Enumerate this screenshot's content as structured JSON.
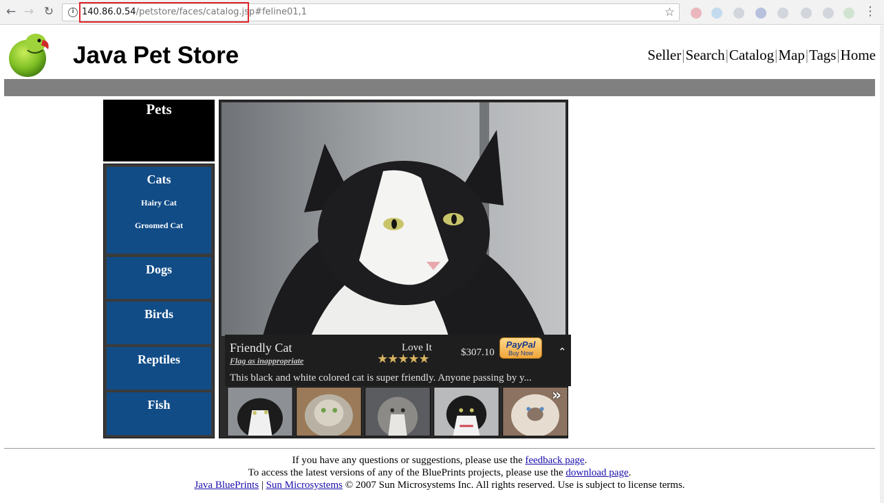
{
  "browser": {
    "url_host": "140.86.0.54",
    "url_path": "/petstore/faces/catalog.jsp",
    "url_hash": "#feline01,1"
  },
  "header": {
    "title": "Java Pet Store",
    "nav": [
      "Seller",
      "Search",
      "Catalog",
      "Map",
      "Tags",
      "Home"
    ],
    "nav_separator": "|"
  },
  "sidebar": {
    "heading": "Pets",
    "categories": [
      {
        "label": "Cats",
        "subcategories": [
          "Hairy Cat",
          "Groomed Cat"
        ]
      },
      {
        "label": "Dogs"
      },
      {
        "label": "Birds"
      },
      {
        "label": "Reptiles"
      },
      {
        "label": "Fish"
      }
    ]
  },
  "item": {
    "name": "Friendly Cat",
    "flag_link": "Flag as inappropriate",
    "rating_label": "Love It",
    "rating_stars": 5,
    "stars_text": "★★★★★",
    "price": "$307.10",
    "paypal_logo": "PayPal",
    "paypal_action": "Buy Now",
    "description": "This black and white colored cat is super friendly. Anyone passing by y..."
  },
  "thumbnails": [
    "tuxedo-cat",
    "long-haired-tabby",
    "gray-tabby",
    "black-white-cat",
    "siamese-cat"
  ],
  "icons": {
    "back": "arrow-left",
    "forward": "arrow-right",
    "reload": "reload",
    "info": "info",
    "bookmark": "star",
    "collapse": "chevron-up",
    "next": "double-chevron-right"
  },
  "colors": {
    "category_blue": "#114c87",
    "header_bar": "#808080",
    "url_highlight": "#e0262b"
  },
  "footer": {
    "line1_prefix": "If you have any questions or suggestions, please use the ",
    "line1_link": "feedback page",
    "line1_suffix": ".",
    "line2_prefix": "To access the latest versions of any of the BluePrints projects, please use the ",
    "line2_link": "download page",
    "line2_suffix": ".",
    "line3_link1": "Java BluePrints",
    "line3_sep": " | ",
    "line3_link2": "Sun Microsystems",
    "line3_text": " © 2007 Sun Microsystems Inc. All rights reserved. Use is subject to license terms."
  }
}
